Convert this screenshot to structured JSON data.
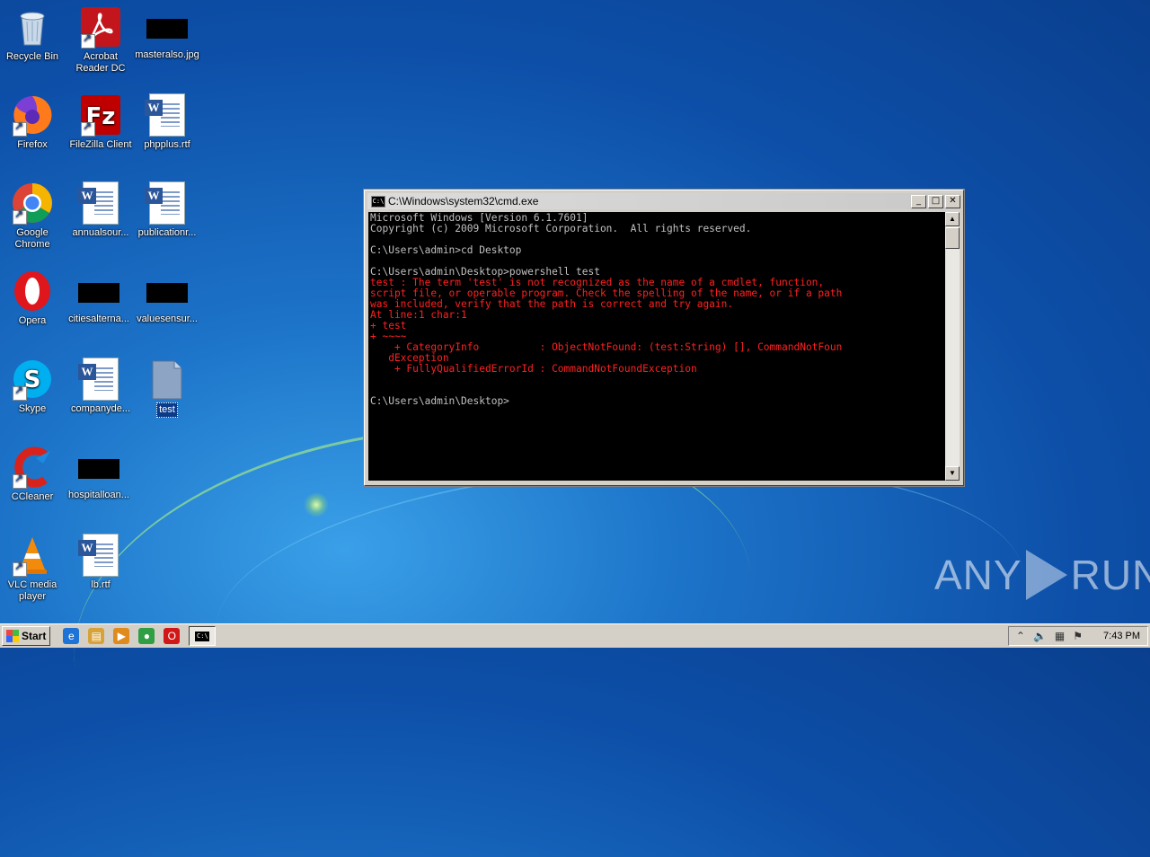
{
  "desktop": {
    "icons": [
      {
        "label": "Recycle Bin"
      },
      {
        "label": "Acrobat Reader DC"
      },
      {
        "label": "masteralso.jpg"
      },
      {
        "label": "Firefox"
      },
      {
        "label": "FileZilla Client"
      },
      {
        "label": "phpplus.rtf"
      },
      {
        "label": "Google Chrome"
      },
      {
        "label": "annualsour..."
      },
      {
        "label": "publicationr..."
      },
      {
        "label": "Opera"
      },
      {
        "label": "citiesalterna..."
      },
      {
        "label": "valuesensur..."
      },
      {
        "label": "Skype"
      },
      {
        "label": "companyde..."
      },
      {
        "label": "test"
      },
      {
        "label": "CCleaner"
      },
      {
        "label": "hospitalloan..."
      },
      {
        "label": "VLC media player"
      },
      {
        "label": "lb.rtf"
      }
    ]
  },
  "cmd": {
    "title": "C:\\Windows\\system32\\cmd.exe",
    "icon_glyph": "C:\\",
    "buttons": {
      "minimize": "_",
      "maximize": "□",
      "close": "✕"
    },
    "lines": [
      {
        "text": "Microsoft Windows [Version 6.1.7601]",
        "error": false
      },
      {
        "text": "Copyright (c) 2009 Microsoft Corporation.  All rights reserved.",
        "error": false
      },
      {
        "text": "",
        "error": false
      },
      {
        "text": "C:\\Users\\admin>cd Desktop",
        "error": false
      },
      {
        "text": "",
        "error": false
      },
      {
        "text": "C:\\Users\\admin\\Desktop>powershell test",
        "error": false
      },
      {
        "text": "test : The term 'test' is not recognized as the name of a cmdlet, function,",
        "error": true
      },
      {
        "text": "script file, or operable program. Check the spelling of the name, or if a path",
        "error": true
      },
      {
        "text": "was included, verify that the path is correct and try again.",
        "error": true
      },
      {
        "text": "At line:1 char:1",
        "error": true
      },
      {
        "text": "+ test",
        "error": true
      },
      {
        "text": "+ ~~~~",
        "error": true
      },
      {
        "text": "    + CategoryInfo          : ObjectNotFound: (test:String) [], CommandNotFoun",
        "error": true
      },
      {
        "text": "   dException",
        "error": true
      },
      {
        "text": "    + FullyQualifiedErrorId : CommandNotFoundException",
        "error": true
      },
      {
        "text": "",
        "error": false
      },
      {
        "text": "",
        "error": false
      },
      {
        "text": "C:\\Users\\admin\\Desktop>",
        "error": false
      }
    ]
  },
  "watermark": {
    "left": "ANY",
    "right": "RUN"
  },
  "taskbar": {
    "start_label": "Start",
    "quick_launch": [
      {
        "icon": "ie-icon",
        "glyph": "e",
        "color": "#1e73d6"
      },
      {
        "icon": "explorer-icon",
        "glyph": "▤",
        "color": "#d8a23a"
      },
      {
        "icon": "media-player-icon",
        "glyph": "▶",
        "color": "#e08a1e"
      },
      {
        "icon": "chrome-icon",
        "glyph": "●",
        "color": "#2f9e44"
      },
      {
        "icon": "opera-icon",
        "glyph": "O",
        "color": "#d01818"
      }
    ],
    "task_glyph": "C:\\",
    "clock": "7:43 PM"
  }
}
